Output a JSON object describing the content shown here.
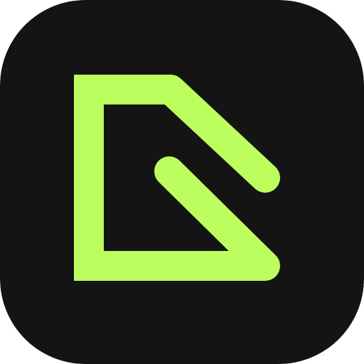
{
  "app_icon": {
    "icon_name": "abstract-angular-logo-icon",
    "colors": {
      "background": "#141414",
      "glyph": "#BDFE5F"
    }
  }
}
